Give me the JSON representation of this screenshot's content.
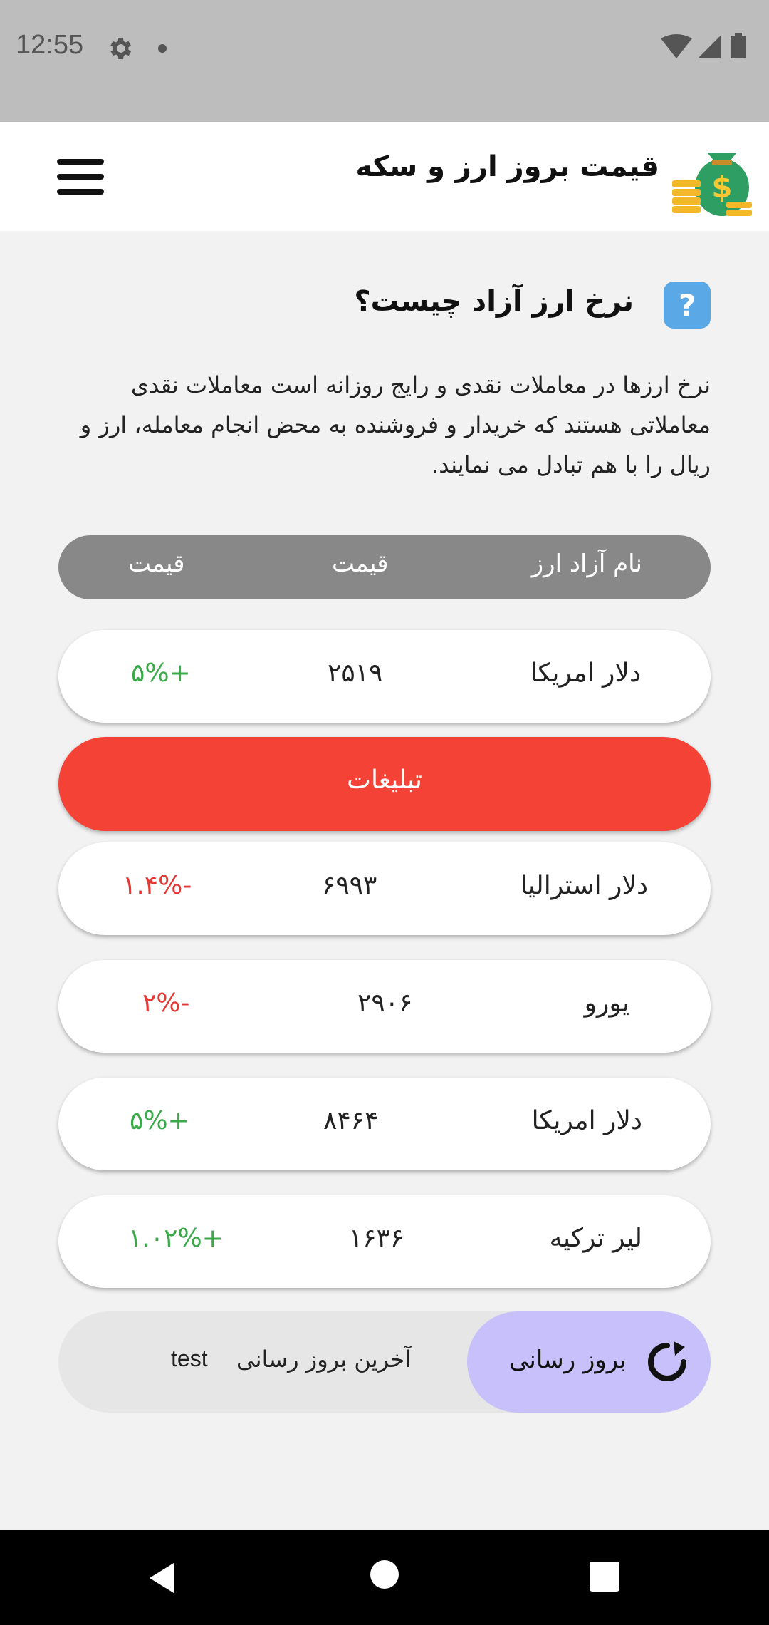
{
  "status_bar": {
    "time": "12:55"
  },
  "app_bar": {
    "title": "قیمت بروز ارز و سکه"
  },
  "section": {
    "heading": "نرخ ارز آزاد چیست؟",
    "intro": "نرخ ارزها در معاملات نقدی و رایج روزانه است معاملات نقدی معاملاتی هستند که خریدار و فروشنده به محض انجام معامله، ارز و ریال را با هم تبادل می نمایند."
  },
  "table_header": {
    "col_name": "نام آزاد ارز",
    "col_price": "قیمت",
    "col_change": "قیمت"
  },
  "rows": [
    {
      "name": "دلار امریکا",
      "price": "۲۵۱۹",
      "change": "+۵%",
      "direction": "up"
    },
    {
      "name": "دلار استرالیا",
      "price": "۶۹۹۳",
      "change": "-۱.۴%",
      "direction": "down"
    },
    {
      "name": "یورو",
      "price": "۲۹۰۶",
      "change": "-۲%",
      "direction": "down"
    },
    {
      "name": "دلار امریکا",
      "price": "۸۴۶۴",
      "change": "+۵%",
      "direction": "up"
    },
    {
      "name": "لیر ترکیه",
      "price": "۱۶۳۶",
      "change": "+۱.۰۲%",
      "direction": "up"
    }
  ],
  "ad": {
    "label": "تبلیغات"
  },
  "footer": {
    "refresh_label": "بروز رسانی",
    "last_update_label": "آخرین بروز رسانی",
    "last_update_value": "test"
  },
  "colors": {
    "ad": "#f44336",
    "refresh_button": "#c7c0fb",
    "header_pill": "#888888",
    "positive": "#3aa94a",
    "negative": "#e53935"
  },
  "icons": [
    "settings-icon",
    "wifi-icon",
    "cellular-icon",
    "battery-icon",
    "money-bag-icon",
    "hamburger-menu-icon",
    "help-icon",
    "refresh-icon",
    "back-icon",
    "home-icon",
    "recents-icon"
  ]
}
